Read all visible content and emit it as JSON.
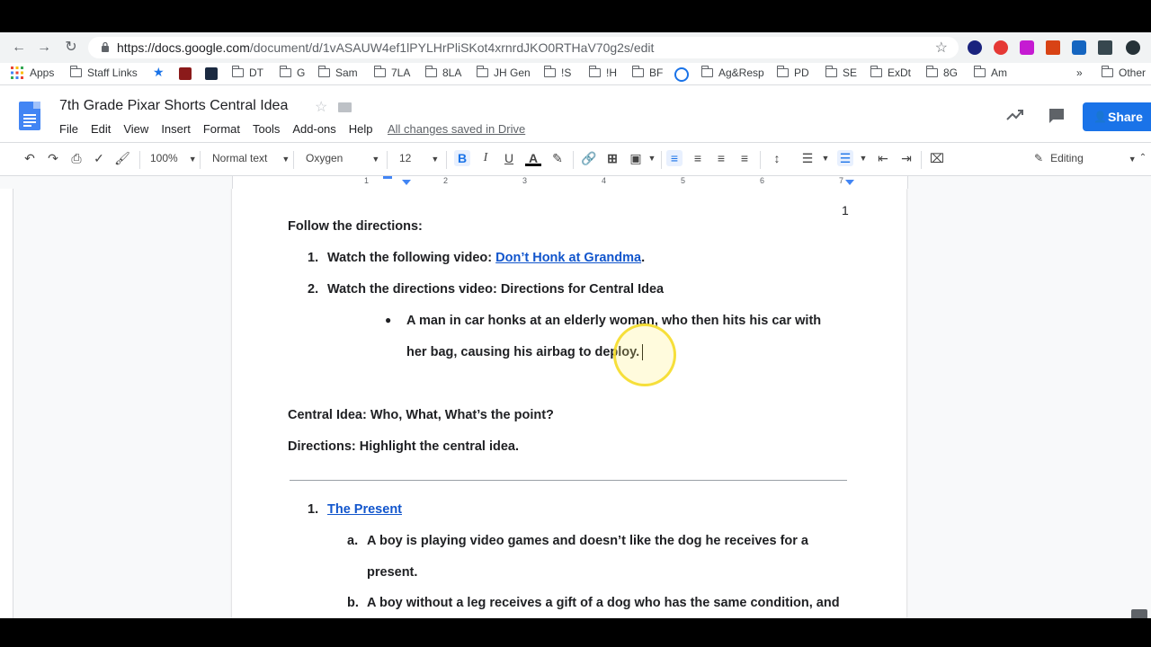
{
  "browser": {
    "url_main": "https://docs.google.com",
    "url_path": "/document/d/1vASAUW4ef1lPYLHrPliSKot4xrnrdJKO0RTHaV70g2s/edit"
  },
  "bookmarks": {
    "apps": "Apps",
    "items": [
      "Staff Links",
      "DT",
      "G",
      "Sam",
      "7LA",
      "8LA",
      "JH Gen",
      "!S",
      "!H",
      "BF",
      "Ag&Resp",
      "PD",
      "SE",
      "ExDt",
      "8G",
      "Am"
    ],
    "more": "»",
    "other": "Other"
  },
  "docs": {
    "title": "7th Grade Pixar Shorts Central Idea",
    "menu": [
      "File",
      "Edit",
      "View",
      "Insert",
      "Format",
      "Tools",
      "Add-ons",
      "Help"
    ],
    "saved_status": "All changes saved in Drive",
    "share_label": "Share"
  },
  "toolbar": {
    "zoom": "100%",
    "style": "Normal text",
    "font": "Oxygen",
    "font_size": "12",
    "mode": "Editing",
    "bold": "B",
    "italic": "I",
    "underline": "U",
    "text_color": "A"
  },
  "ruler": {
    "marks": [
      "1",
      "1",
      "2",
      "3",
      "4",
      "5",
      "6",
      "7"
    ]
  },
  "document": {
    "page_number": "1",
    "heading": "Follow the directions:",
    "step1_num": "1.",
    "step1_text": "Watch the following video: ",
    "step1_link": "Don’t Honk at Grandma",
    "step1_period": ".",
    "step2_num": "2.",
    "step2_text": "Watch the directions video: Directions for Central Idea",
    "bullet_glyph": "●",
    "bullet_line1": "A man in car honks at an elderly woman, who then hits his car with",
    "bullet_line2": "her bag, causing his airbag to deploy.",
    "central_idea": "Central Idea: Who, What, What’s the point?",
    "directions": "Directions: Highlight the central idea.",
    "item1_num": "1.",
    "item1_link": "The Present",
    "a_label": "a.",
    "a_line1": "A boy is playing video games and doesn’t like the dog he receives for a",
    "a_line2": "present.",
    "b_label": "b.",
    "b_line1": "A boy without a leg receives a gift of a dog who has the same condition, and"
  },
  "colors": {
    "link": "#1155cc",
    "share": "#1a73e8",
    "docs_blue": "#4285f4"
  }
}
